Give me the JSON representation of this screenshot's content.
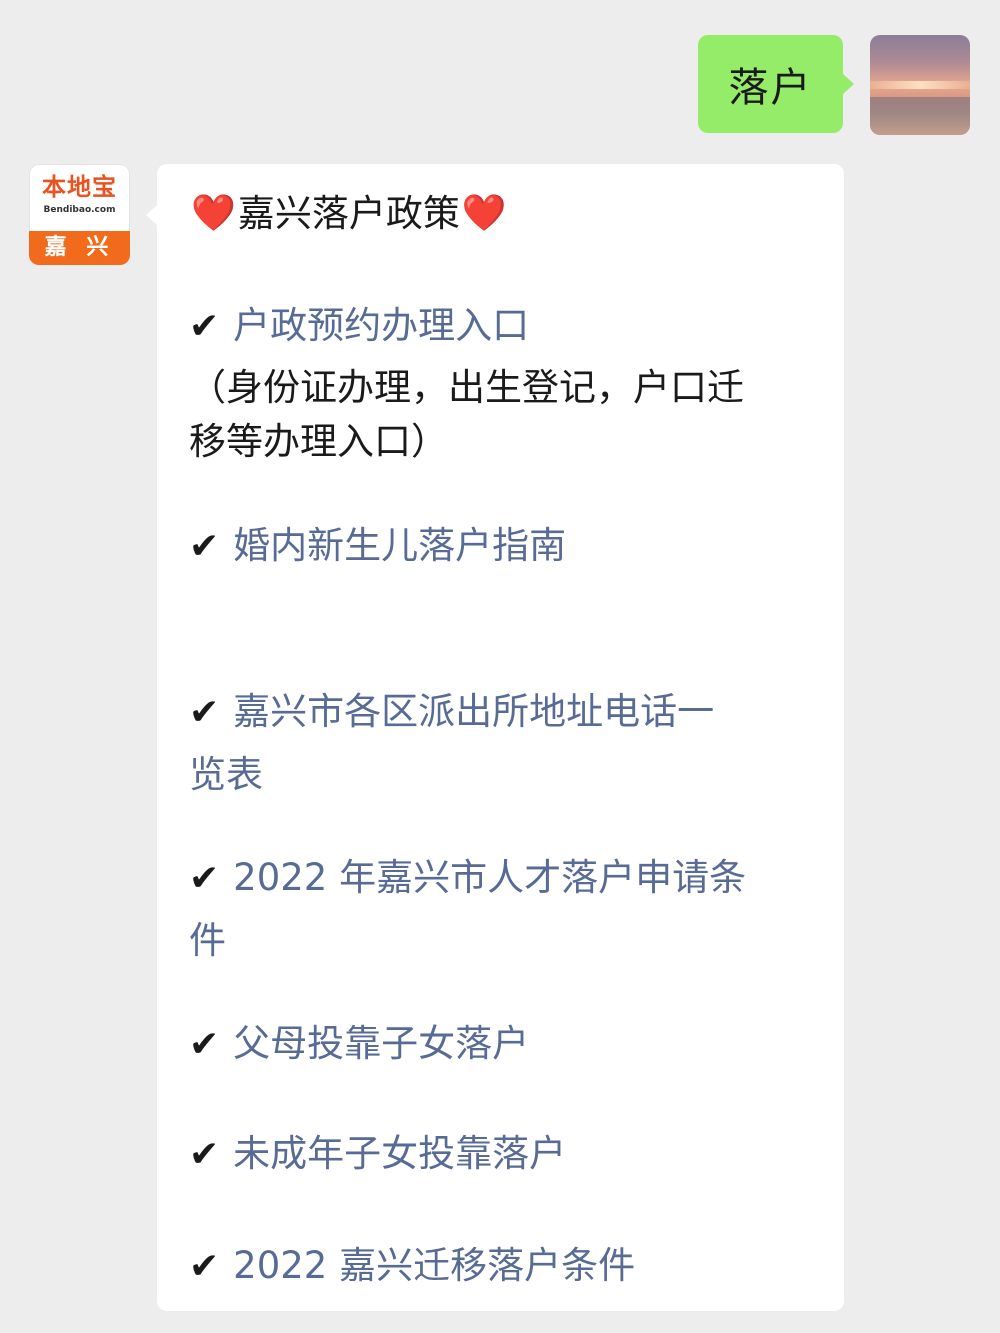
{
  "chat": {
    "user_message": "落户",
    "bot_logo": {
      "top_text": "本地宝",
      "domain_text": "Bendibao.com",
      "city_text": "嘉 兴"
    },
    "bot_title": "嘉兴落户政策",
    "heart_icon": "❤️",
    "check_mark": "✔",
    "items": [
      {
        "label": "户政预约办理入口",
        "note_line1": "（身份证办理，出生登记，户口迁",
        "note_line2": "移等办理入口）"
      },
      {
        "label": "婚内新生儿落户指南"
      },
      {
        "label_line1": "嘉兴市各区派出所地址电话一",
        "label_line2": "览表"
      },
      {
        "label_line1": "2022 年嘉兴市人才落户申请条",
        "label_line2": "件"
      },
      {
        "label": "父母投靠子女落户"
      },
      {
        "label": "未成年子女投靠落户"
      },
      {
        "label": "2022 嘉兴迁移落户条件"
      }
    ]
  },
  "colors": {
    "background": "#ededed",
    "user_bubble": "#95ec69",
    "bot_bubble": "#ffffff",
    "link": "#576b95",
    "logo_orange": "#f26b1d"
  }
}
